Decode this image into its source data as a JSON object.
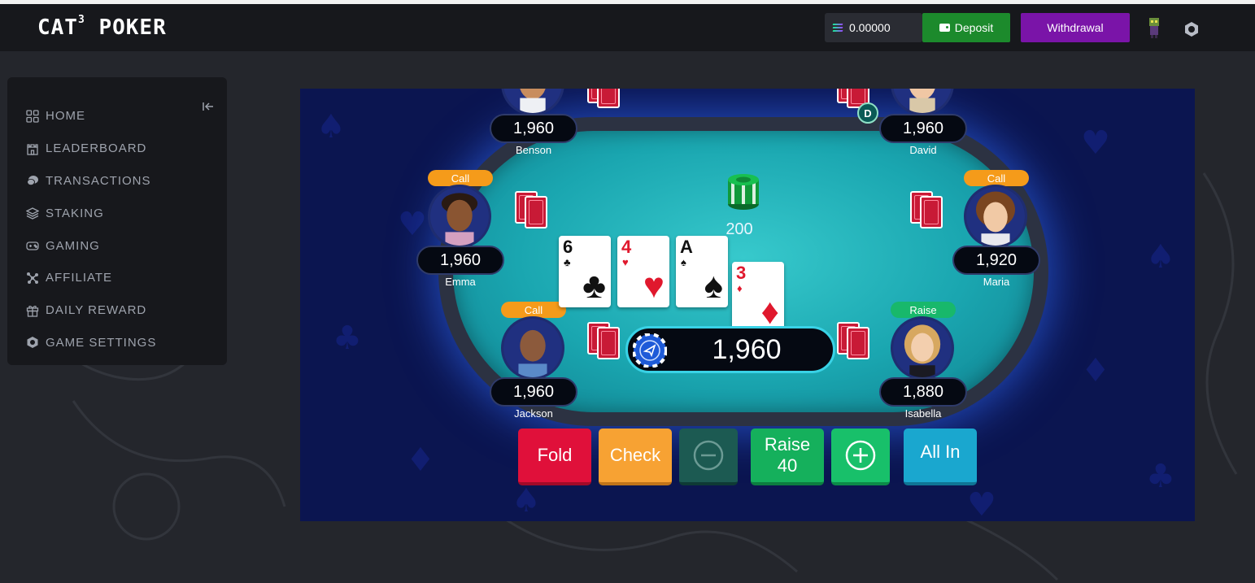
{
  "app": {
    "logo_main": "CAT",
    "logo_sup": "3",
    "logo_tail": " POKER"
  },
  "header": {
    "balance": "0.00000",
    "deposit_label": "Deposit",
    "withdraw_label": "Withdrawal",
    "icons": [
      "solana-icon",
      "wallet-icon",
      "user-avatar",
      "gear-icon"
    ]
  },
  "sidebar": {
    "items": [
      {
        "label": "HOME",
        "icon": "home-grid-icon"
      },
      {
        "label": "LEADERBOARD",
        "icon": "castle-icon"
      },
      {
        "label": "TRANSACTIONS",
        "icon": "coins-icon"
      },
      {
        "label": "STAKING",
        "icon": "layers-icon"
      },
      {
        "label": "GAMING",
        "icon": "gamepad-icon"
      },
      {
        "label": "AFFILIATE",
        "icon": "affiliate-icon"
      },
      {
        "label": "DAILY REWARD",
        "icon": "gift-icon"
      },
      {
        "label": "GAME SETTINGS",
        "icon": "settings-icon"
      }
    ]
  },
  "table": {
    "pot": "200",
    "dealer_label": "D",
    "players": [
      {
        "name": "Benson",
        "stack": "1,960",
        "action": ""
      },
      {
        "name": "David",
        "stack": "1,960",
        "action": ""
      },
      {
        "name": "Emma",
        "stack": "1,960",
        "action": "Call"
      },
      {
        "name": "Maria",
        "stack": "1,920",
        "action": "Call"
      },
      {
        "name": "Jackson",
        "stack": "1,960",
        "action": "Call"
      },
      {
        "name": "Isabella",
        "stack": "1,880",
        "action": "Raise"
      }
    ],
    "community_cards": [
      {
        "rank": "6",
        "suit": "♣",
        "color": "black"
      },
      {
        "rank": "4",
        "suit": "♥",
        "color": "red"
      },
      {
        "rank": "A",
        "suit": "♠",
        "color": "black"
      },
      {
        "rank": "3",
        "suit": "♦",
        "color": "red"
      }
    ],
    "my_stack": "1,960"
  },
  "actions": {
    "fold": "Fold",
    "check": "Check",
    "raise": "Raise",
    "raise_amount": "40",
    "allin": "All In"
  },
  "colors": {
    "deposit": "#1c8a2c",
    "withdraw": "#7a14a8",
    "fold": "#e0103a",
    "check": "#f7a233",
    "raise": "#15b05c",
    "allin": "#1aa7cf",
    "felt": "#1aa6b0"
  }
}
